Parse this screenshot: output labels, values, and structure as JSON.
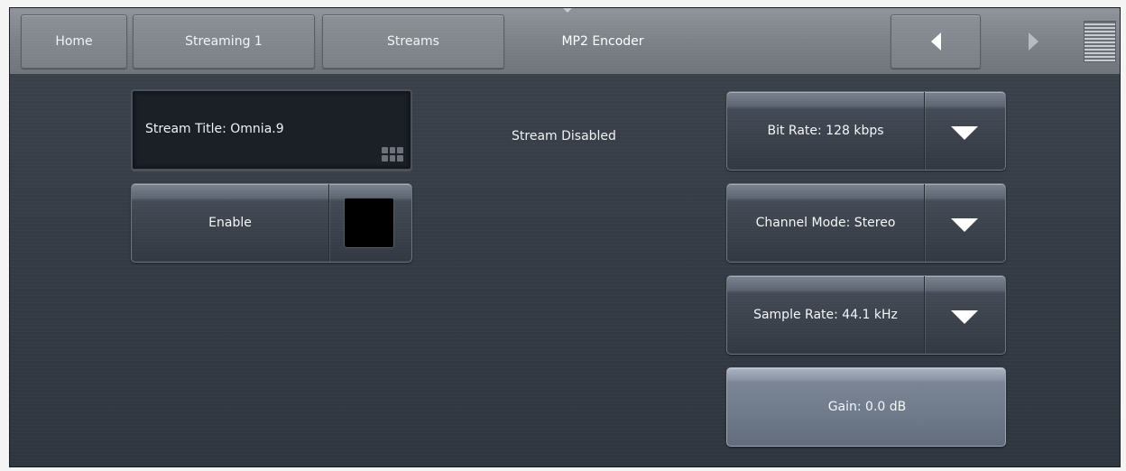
{
  "nav": {
    "home": "Home",
    "streaming": "Streaming 1",
    "streams": "Streams",
    "current": "MP2 Encoder"
  },
  "stream": {
    "title_label": "Stream Title: Omnia.9",
    "status": "Stream Disabled",
    "enable_label": "Enable",
    "enabled": false
  },
  "settings": {
    "bit_rate": "Bit Rate: 128 kbps",
    "channel_mode": "Channel Mode: Stereo",
    "sample_rate": "Sample Rate: 44.1 kHz",
    "gain": "Gain: 0.0 dB"
  },
  "icons": {
    "back": "arrow-left-icon",
    "forward": "arrow-right-icon",
    "menu": "menu-lines-icon",
    "keypad": "keypad-icon",
    "dropdown": "triangle-down-icon"
  }
}
